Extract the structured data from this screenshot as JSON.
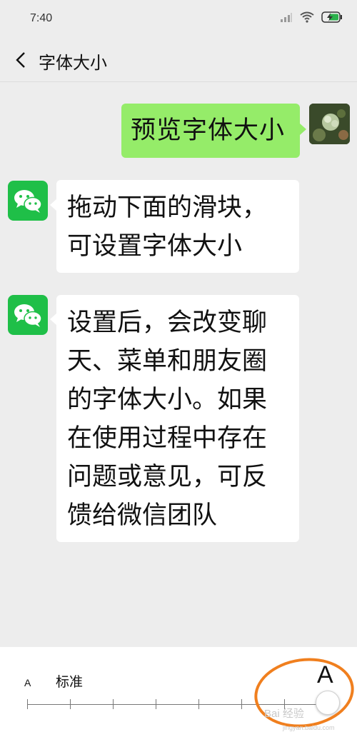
{
  "status_bar": {
    "time": "7:40"
  },
  "header": {
    "title": "字体大小"
  },
  "messages": [
    {
      "text": "预览字体大小"
    },
    {
      "text": "拖动下面的滑块，可设置字体大小"
    },
    {
      "text": "设置后，会改变聊天、菜单和朋友圈的字体大小。如果在使用过程中存在问题或意见，可反馈给微信团队"
    }
  ],
  "slider": {
    "small_label": "A",
    "standard_label": "标准",
    "large_label": "A",
    "level": 1.0
  },
  "watermark": {
    "main": "Bai 经验",
    "sub": "jingyan.baidu.com"
  },
  "colors": {
    "self_bubble": "#95ec69",
    "wechat_green": "#1fbf48",
    "highlight": "#f07f1e"
  }
}
